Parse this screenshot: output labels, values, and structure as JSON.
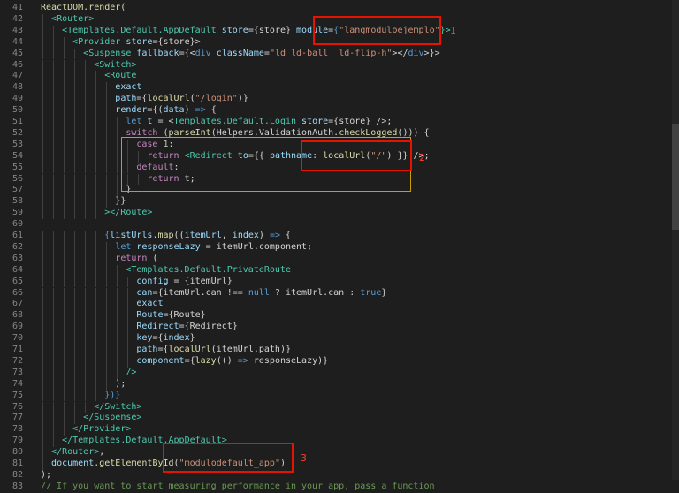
{
  "editor": {
    "lines": [
      {
        "n": "41",
        "t": [
          [
            "ReactDOM.render(",
            "#dcdcaa"
          ]
        ]
      },
      {
        "n": "42",
        "t": [
          [
            "  ",
            ""
          ],
          [
            "<Router>",
            "#4ec9b0"
          ]
        ]
      },
      {
        "n": "43",
        "t": [
          [
            "    ",
            ""
          ],
          [
            "<Templates.Default.AppDefault ",
            "#4ec9b0"
          ],
          [
            "store",
            "#9cdcfe"
          ],
          [
            "=",
            "#d4d4d4"
          ],
          [
            "{store}",
            "#d4d4d4"
          ],
          [
            " module",
            "#9cdcfe"
          ],
          [
            "=",
            "#d4d4d4"
          ],
          [
            "{",
            "#569cd6"
          ],
          [
            "\"langmoduloejemplo\"",
            "#ce9178"
          ],
          [
            "}>",
            "#4ec9b0"
          ]
        ]
      },
      {
        "n": "44",
        "t": [
          [
            "      ",
            ""
          ],
          [
            "<Provider ",
            "#4ec9b0"
          ],
          [
            "store",
            "#9cdcfe"
          ],
          [
            "={store}>",
            "#d4d4d4"
          ]
        ]
      },
      {
        "n": "45",
        "t": [
          [
            "        ",
            ""
          ],
          [
            "<Suspense ",
            "#4ec9b0"
          ],
          [
            "fallback",
            "#9cdcfe"
          ],
          [
            "={<",
            "#d4d4d4"
          ],
          [
            "div ",
            "#569cd6"
          ],
          [
            "className",
            "#9cdcfe"
          ],
          [
            "=",
            "#d4d4d4"
          ],
          [
            "\"ld ld-ball  ld-flip-h\"",
            "#ce9178"
          ],
          [
            "></",
            "#d4d4d4"
          ],
          [
            "div",
            "#569cd6"
          ],
          [
            ">}>",
            "#d4d4d4"
          ]
        ]
      },
      {
        "n": "46",
        "t": [
          [
            "          ",
            ""
          ],
          [
            "<Switch>",
            "#4ec9b0"
          ]
        ]
      },
      {
        "n": "47",
        "t": [
          [
            "            ",
            ""
          ],
          [
            "<Route",
            "#4ec9b0"
          ]
        ]
      },
      {
        "n": "48",
        "t": [
          [
            "              ",
            ""
          ],
          [
            "exact",
            "#9cdcfe"
          ]
        ]
      },
      {
        "n": "49",
        "t": [
          [
            "              ",
            ""
          ],
          [
            "path",
            "#9cdcfe"
          ],
          [
            "={",
            "#d4d4d4"
          ],
          [
            "localUrl",
            "#dcdcaa"
          ],
          [
            "(",
            "#d4d4d4"
          ],
          [
            "\"/login\"",
            "#ce9178"
          ],
          [
            ")}",
            "#d4d4d4"
          ]
        ]
      },
      {
        "n": "50",
        "t": [
          [
            "              ",
            ""
          ],
          [
            "render",
            "#9cdcfe"
          ],
          [
            "={(",
            "#d4d4d4"
          ],
          [
            "data",
            "#9cdcfe"
          ],
          [
            ") ",
            "#d4d4d4"
          ],
          [
            "=>",
            "#569cd6"
          ],
          [
            " {",
            "#d4d4d4"
          ]
        ]
      },
      {
        "n": "51",
        "t": [
          [
            "                ",
            ""
          ],
          [
            "let ",
            "#569cd6"
          ],
          [
            "t",
            "#9cdcfe"
          ],
          [
            " = <",
            "#d4d4d4"
          ],
          [
            "Templates.Default.Login ",
            "#4ec9b0"
          ],
          [
            "store",
            "#9cdcfe"
          ],
          [
            "={store} />;",
            "#d4d4d4"
          ]
        ]
      },
      {
        "n": "52",
        "t": [
          [
            "                ",
            ""
          ],
          [
            "switch ",
            "#c586c0"
          ],
          [
            "(",
            "#d4d4d4"
          ],
          [
            "parseInt",
            "#dcdcaa"
          ],
          [
            "(Helpers.ValidationAuth.",
            "#d4d4d4"
          ],
          [
            "checkLogged",
            "#dcdcaa"
          ],
          [
            "())) {",
            "#d4d4d4"
          ]
        ]
      },
      {
        "n": "53",
        "t": [
          [
            "                  ",
            ""
          ],
          [
            "case ",
            "#c586c0"
          ],
          [
            "1",
            "#b5cea8"
          ],
          [
            ":",
            "#d4d4d4"
          ]
        ]
      },
      {
        "n": "54",
        "t": [
          [
            "                    ",
            ""
          ],
          [
            "return ",
            "#c586c0"
          ],
          [
            "<Redirect ",
            "#4ec9b0"
          ],
          [
            "to",
            "#9cdcfe"
          ],
          [
            "={{ ",
            "#d4d4d4"
          ],
          [
            "pathname",
            "#9cdcfe"
          ],
          [
            ": ",
            "#d4d4d4"
          ],
          [
            "localUrl",
            "#dcdcaa"
          ],
          [
            "(",
            "#d4d4d4"
          ],
          [
            "\"/\"",
            "#ce9178"
          ],
          [
            ") }} />;",
            "#d4d4d4"
          ]
        ]
      },
      {
        "n": "55",
        "t": [
          [
            "                  ",
            ""
          ],
          [
            "default",
            "#c586c0"
          ],
          [
            ":",
            "#d4d4d4"
          ]
        ]
      },
      {
        "n": "56",
        "t": [
          [
            "                    ",
            ""
          ],
          [
            "return ",
            "#c586c0"
          ],
          [
            "t;",
            "#d4d4d4"
          ]
        ]
      },
      {
        "n": "57",
        "t": [
          [
            "                ",
            ""
          ],
          [
            "}",
            "#d4d4d4"
          ]
        ]
      },
      {
        "n": "58",
        "t": [
          [
            "              ",
            ""
          ],
          [
            "}}",
            "#d4d4d4"
          ]
        ]
      },
      {
        "n": "59",
        "t": [
          [
            "            ",
            ""
          ],
          [
            "></Route>",
            "#4ec9b0"
          ]
        ]
      },
      {
        "n": "60",
        "t": []
      },
      {
        "n": "61",
        "t": [
          [
            "            ",
            ""
          ],
          [
            "{",
            "#569cd6"
          ],
          [
            "listUrls",
            "#9cdcfe"
          ],
          [
            ".",
            "#d4d4d4"
          ],
          [
            "map",
            "#dcdcaa"
          ],
          [
            "((",
            "#d4d4d4"
          ],
          [
            "itemUrl",
            "#9cdcfe"
          ],
          [
            ", ",
            "#d4d4d4"
          ],
          [
            "index",
            "#9cdcfe"
          ],
          [
            ") ",
            "#d4d4d4"
          ],
          [
            "=>",
            "#569cd6"
          ],
          [
            " {",
            "#d4d4d4"
          ]
        ]
      },
      {
        "n": "62",
        "t": [
          [
            "              ",
            ""
          ],
          [
            "let ",
            "#569cd6"
          ],
          [
            "responseLazy",
            "#9cdcfe"
          ],
          [
            " = itemUrl.component;",
            "#d4d4d4"
          ]
        ]
      },
      {
        "n": "63",
        "t": [
          [
            "              ",
            ""
          ],
          [
            "return ",
            "#c586c0"
          ],
          [
            "(",
            "#d4d4d4"
          ]
        ]
      },
      {
        "n": "64",
        "t": [
          [
            "                ",
            ""
          ],
          [
            "<Templates.Default.PrivateRoute",
            "#4ec9b0"
          ]
        ]
      },
      {
        "n": "65",
        "t": [
          [
            "                  ",
            ""
          ],
          [
            "config",
            "#9cdcfe"
          ],
          [
            " = {itemUrl}",
            "#d4d4d4"
          ]
        ]
      },
      {
        "n": "66",
        "t": [
          [
            "                  ",
            ""
          ],
          [
            "can",
            "#9cdcfe"
          ],
          [
            "={itemUrl.can !== ",
            "#d4d4d4"
          ],
          [
            "null",
            "#569cd6"
          ],
          [
            " ? itemUrl.can : ",
            "#d4d4d4"
          ],
          [
            "true",
            "#569cd6"
          ],
          [
            "}",
            "#d4d4d4"
          ]
        ]
      },
      {
        "n": "67",
        "t": [
          [
            "                  ",
            ""
          ],
          [
            "exact",
            "#9cdcfe"
          ]
        ]
      },
      {
        "n": "68",
        "t": [
          [
            "                  ",
            ""
          ],
          [
            "Route",
            "#9cdcfe"
          ],
          [
            "={Route}",
            "#d4d4d4"
          ]
        ]
      },
      {
        "n": "69",
        "t": [
          [
            "                  ",
            ""
          ],
          [
            "Redirect",
            "#9cdcfe"
          ],
          [
            "={Redirect}",
            "#d4d4d4"
          ]
        ]
      },
      {
        "n": "70",
        "t": [
          [
            "                  ",
            ""
          ],
          [
            "key",
            "#9cdcfe"
          ],
          [
            "={",
            "#d4d4d4"
          ],
          [
            "index",
            "#9cdcfe"
          ],
          [
            "}",
            "#d4d4d4"
          ]
        ]
      },
      {
        "n": "71",
        "t": [
          [
            "                  ",
            ""
          ],
          [
            "path",
            "#9cdcfe"
          ],
          [
            "={",
            "#d4d4d4"
          ],
          [
            "localUrl",
            "#dcdcaa"
          ],
          [
            "(itemUrl.path)}",
            "#d4d4d4"
          ]
        ]
      },
      {
        "n": "72",
        "t": [
          [
            "                  ",
            ""
          ],
          [
            "component",
            "#9cdcfe"
          ],
          [
            "={",
            "#d4d4d4"
          ],
          [
            "lazy",
            "#dcdcaa"
          ],
          [
            "(() ",
            "#d4d4d4"
          ],
          [
            "=>",
            "#569cd6"
          ],
          [
            " responseLazy)}",
            "#d4d4d4"
          ]
        ]
      },
      {
        "n": "73",
        "t": [
          [
            "                ",
            ""
          ],
          [
            "/>",
            "#4ec9b0"
          ]
        ]
      },
      {
        "n": "74",
        "t": [
          [
            "              ",
            ""
          ],
          [
            ");",
            "#d4d4d4"
          ]
        ]
      },
      {
        "n": "75",
        "t": [
          [
            "            ",
            ""
          ],
          [
            "})}",
            "#569cd6"
          ]
        ]
      },
      {
        "n": "76",
        "t": [
          [
            "          ",
            ""
          ],
          [
            "</Switch>",
            "#4ec9b0"
          ]
        ]
      },
      {
        "n": "77",
        "t": [
          [
            "        ",
            ""
          ],
          [
            "</Suspense>",
            "#4ec9b0"
          ]
        ]
      },
      {
        "n": "78",
        "t": [
          [
            "      ",
            ""
          ],
          [
            "</Provider>",
            "#4ec9b0"
          ]
        ]
      },
      {
        "n": "79",
        "t": [
          [
            "    ",
            ""
          ],
          [
            "</Templates.Default.AppDefault>",
            "#4ec9b0"
          ]
        ]
      },
      {
        "n": "80",
        "t": [
          [
            "  ",
            ""
          ],
          [
            "</Router>",
            "#4ec9b0"
          ],
          [
            ",",
            "#d4d4d4"
          ]
        ]
      },
      {
        "n": "81",
        "t": [
          [
            "  ",
            ""
          ],
          [
            "document",
            "#9cdcfe"
          ],
          [
            ".",
            "#d4d4d4"
          ],
          [
            "getElementById",
            "#dcdcaa"
          ],
          [
            "(",
            "#d4d4d4"
          ],
          [
            "\"modulodefault_app\"",
            "#ce9178"
          ],
          [
            ")",
            "#d4d4d4"
          ]
        ]
      },
      {
        "n": "82",
        "t": [
          [
            ");",
            "#d4d4d4"
          ]
        ]
      },
      {
        "n": "83",
        "t": [
          [
            "// If you want to start measuring performance in your app, pass a function",
            "#6a9955"
          ]
        ]
      }
    ]
  },
  "annotations": {
    "labels": [
      "1",
      "2",
      "3"
    ],
    "color": "#e51400"
  }
}
